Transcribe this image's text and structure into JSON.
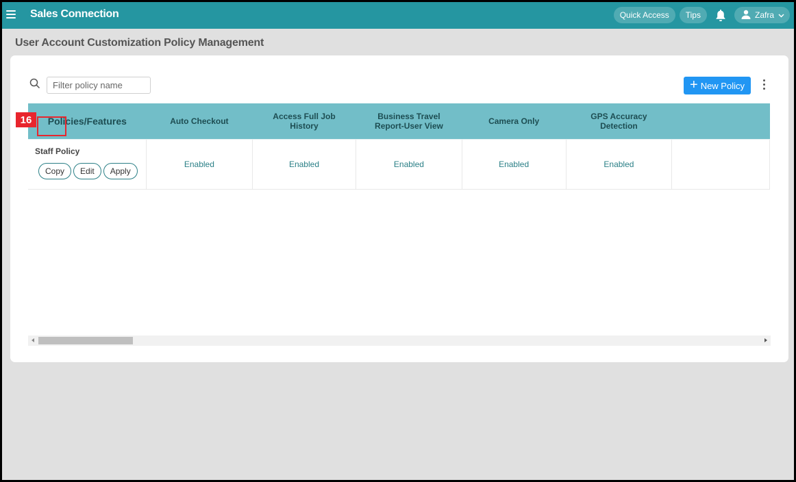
{
  "header": {
    "app_title": "Sales Connection",
    "quick_access_label": "Quick Access",
    "tips_label": "Tips",
    "user_name": "Zafra",
    "icons": {
      "menu": "hamburger-menu-icon",
      "notifications": "bell-icon",
      "user": "user-icon",
      "dropdown": "chevron-down-icon"
    }
  },
  "page": {
    "title": "User Account Customization Policy Management"
  },
  "toolbar": {
    "search_placeholder": "Filter policy name",
    "search_value": "",
    "new_policy_label": "New Policy",
    "icons": {
      "search": "search-icon",
      "add": "plus-icon",
      "more": "more-vertical-icon"
    }
  },
  "table": {
    "columns": [
      "Policies/Features",
      "Auto Checkout",
      "Access Full Job History",
      "Business Travel Report-User View",
      "Camera Only",
      "GPS Accuracy Detection"
    ],
    "rows": [
      {
        "name": "Staff Policy",
        "actions": [
          "Copy",
          "Edit",
          "Apply"
        ],
        "values": [
          "Enabled",
          "Enabled",
          "Enabled",
          "Enabled",
          "Enabled"
        ]
      }
    ]
  },
  "annotation": {
    "label": "16",
    "color": "#e8252d"
  },
  "colors": {
    "topbar": "#2596a1",
    "table_header": "#72bec8",
    "primary_button": "#2196f3",
    "enabled_text": "#2a7f86"
  }
}
